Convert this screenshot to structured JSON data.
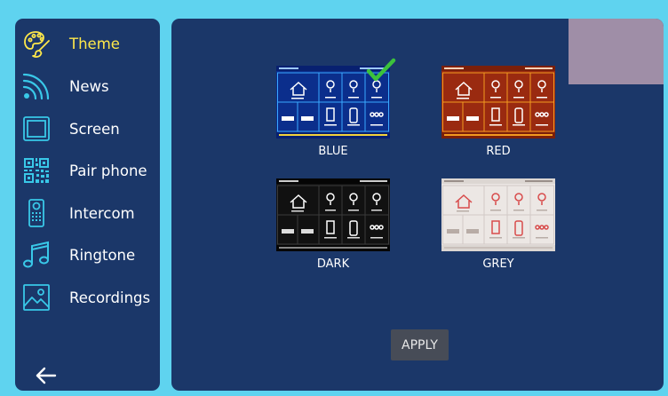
{
  "sidebar": {
    "items": [
      {
        "label": "Theme",
        "icon": "palette-icon",
        "active": true
      },
      {
        "label": "News",
        "icon": "rss-icon",
        "active": false
      },
      {
        "label": "Screen",
        "icon": "screen-icon",
        "active": false
      },
      {
        "label": "Pair phone",
        "icon": "qr-code-icon",
        "active": false
      },
      {
        "label": "Intercom",
        "icon": "intercom-icon",
        "active": false
      },
      {
        "label": "Ringtone",
        "icon": "music-note-icon",
        "active": false
      },
      {
        "label": "Recordings",
        "icon": "image-icon",
        "active": false
      }
    ],
    "back_icon": "arrow-left-icon"
  },
  "themes": [
    {
      "name": "BLUE",
      "selected": true
    },
    {
      "name": "RED",
      "selected": false
    },
    {
      "name": "DARK",
      "selected": false
    },
    {
      "name": "GREY",
      "selected": false
    }
  ],
  "apply_label": "APPLY",
  "colors": {
    "background": "#5fd3ef",
    "panel": "#1b3769",
    "active_label": "#ffe84a",
    "accent_icon": "#39c8e8",
    "check": "#3cc23c",
    "apply_button": "#474c57"
  }
}
